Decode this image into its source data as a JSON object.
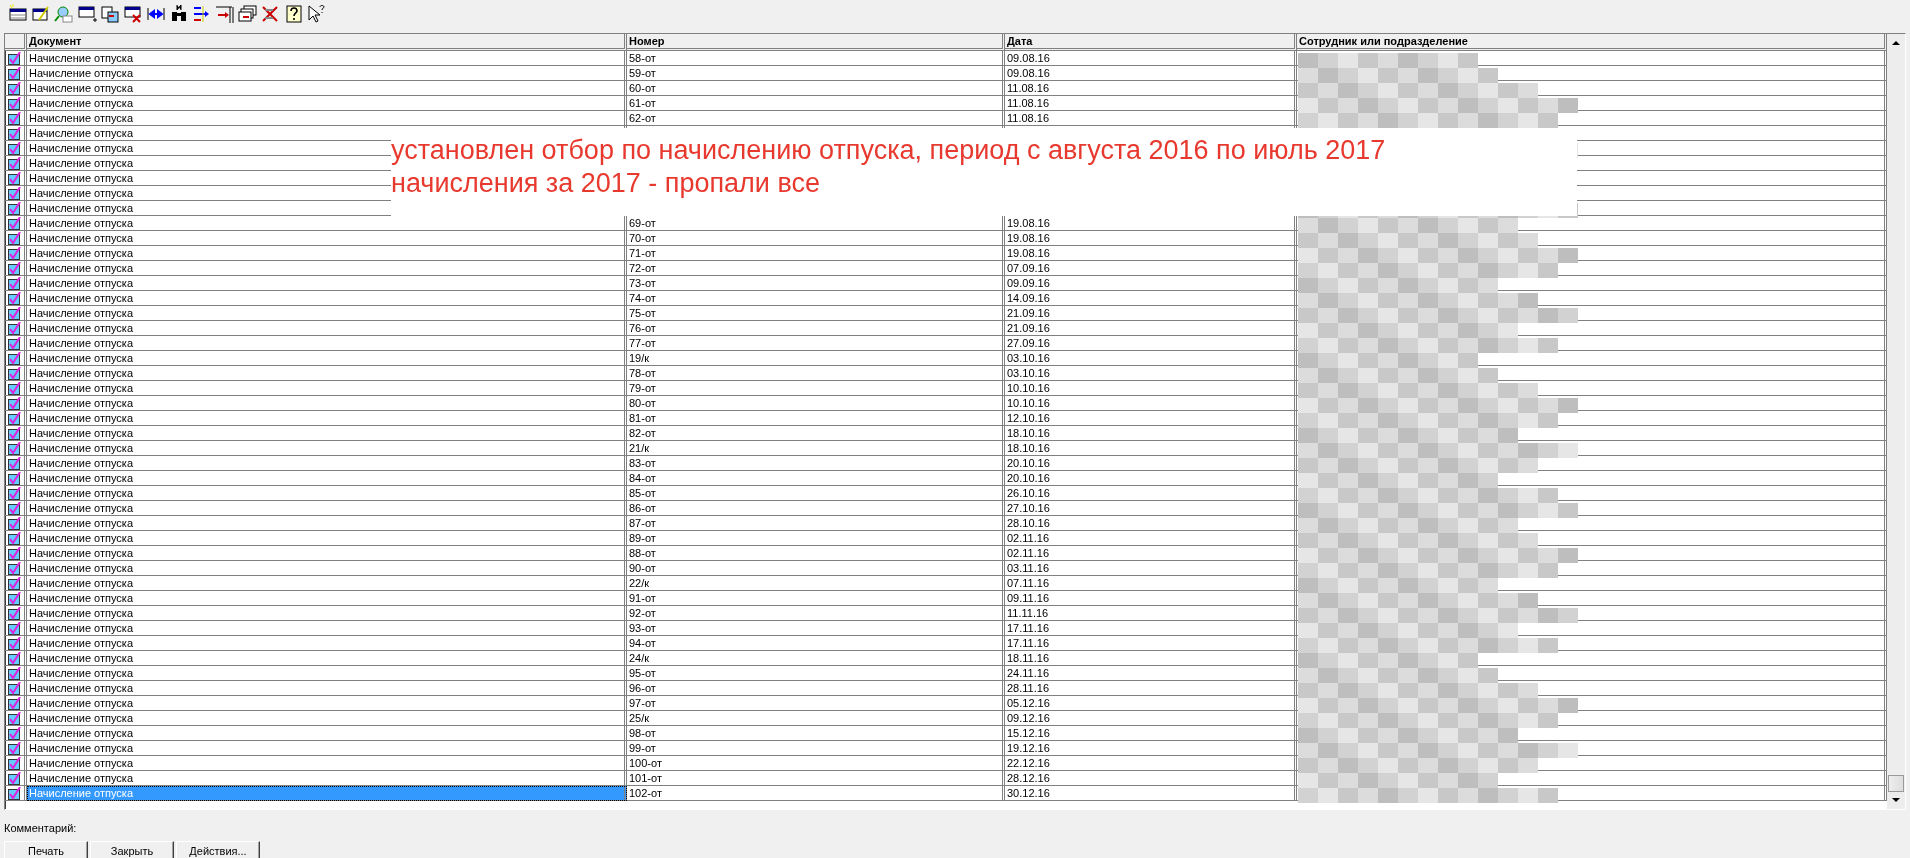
{
  "table": {
    "columns": [
      "Документ",
      "Номер",
      "Дата",
      "Сотрудник или подразделение"
    ],
    "rows": [
      {
        "document": "Начисление отпуска",
        "number": "58-от",
        "date": "09.08.16",
        "selected": false
      },
      {
        "document": "Начисление отпуска",
        "number": "59-от",
        "date": "09.08.16",
        "selected": false
      },
      {
        "document": "Начисление отпуска",
        "number": "60-от",
        "date": "11.08.16",
        "selected": false
      },
      {
        "document": "Начисление отпуска",
        "number": "61-от",
        "date": "11.08.16",
        "selected": false
      },
      {
        "document": "Начисление отпуска",
        "number": "62-от",
        "date": "11.08.16",
        "selected": false
      },
      {
        "document": "Начисление отпуска",
        "selected": false
      },
      {
        "document": "Начисление отпуска",
        "selected": false
      },
      {
        "document": "Начисление отпуска",
        "selected": false
      },
      {
        "document": "Начисление отпуска",
        "selected": false
      },
      {
        "document": "Начисление отпуска",
        "selected": false
      },
      {
        "document": "Начисление отпуска",
        "selected": false
      },
      {
        "document": "Начисление отпуска",
        "number": "69-от",
        "date": "19.08.16",
        "selected": false
      },
      {
        "document": "Начисление отпуска",
        "number": "70-от",
        "date": "19.08.16",
        "selected": false
      },
      {
        "document": "Начисление отпуска",
        "number": "71-от",
        "date": "19.08.16",
        "selected": false
      },
      {
        "document": "Начисление отпуска",
        "number": "72-от",
        "date": "07.09.16",
        "selected": false
      },
      {
        "document": "Начисление отпуска",
        "number": "73-от",
        "date": "09.09.16",
        "selected": false
      },
      {
        "document": "Начисление отпуска",
        "number": "74-от",
        "date": "14.09.16",
        "selected": false
      },
      {
        "document": "Начисление отпуска",
        "number": "75-от",
        "date": "21.09.16",
        "selected": false
      },
      {
        "document": "Начисление отпуска",
        "number": "76-от",
        "date": "21.09.16",
        "selected": false
      },
      {
        "document": "Начисление отпуска",
        "number": "77-от",
        "date": "27.09.16",
        "selected": false
      },
      {
        "document": "Начисление отпуска",
        "number": "19/к",
        "date": "03.10.16",
        "selected": false
      },
      {
        "document": "Начисление отпуска",
        "number": "78-от",
        "date": "03.10.16",
        "selected": false
      },
      {
        "document": "Начисление отпуска",
        "number": "79-от",
        "date": "10.10.16",
        "selected": false
      },
      {
        "document": "Начисление отпуска",
        "number": "80-от",
        "date": "10.10.16",
        "selected": false
      },
      {
        "document": "Начисление отпуска",
        "number": "81-от",
        "date": "12.10.16",
        "selected": false
      },
      {
        "document": "Начисление отпуска",
        "number": "82-от",
        "date": "18.10.16",
        "selected": false
      },
      {
        "document": "Начисление отпуска",
        "number": "21/к",
        "date": "18.10.16",
        "selected": false
      },
      {
        "document": "Начисление отпуска",
        "number": "83-от",
        "date": "20.10.16",
        "selected": false
      },
      {
        "document": "Начисление отпуска",
        "number": "84-от",
        "date": "20.10.16",
        "selected": false
      },
      {
        "document": "Начисление отпуска",
        "number": "85-от",
        "date": "26.10.16",
        "selected": false
      },
      {
        "document": "Начисление отпуска",
        "number": "86-от",
        "date": "27.10.16",
        "selected": false
      },
      {
        "document": "Начисление отпуска",
        "number": "87-от",
        "date": "28.10.16",
        "selected": false
      },
      {
        "document": "Начисление отпуска",
        "number": "89-от",
        "date": "02.11.16",
        "selected": false
      },
      {
        "document": "Начисление отпуска",
        "number": "88-от",
        "date": "02.11.16",
        "selected": false
      },
      {
        "document": "Начисление отпуска",
        "number": "90-от",
        "date": "03.11.16",
        "selected": false
      },
      {
        "document": "Начисление отпуска",
        "number": "22/к",
        "date": "07.11.16",
        "selected": false
      },
      {
        "document": "Начисление отпуска",
        "number": "91-от",
        "date": "09.11.16",
        "selected": false
      },
      {
        "document": "Начисление отпуска",
        "number": "92-от",
        "date": "11.11.16",
        "selected": false
      },
      {
        "document": "Начисление отпуска",
        "number": "93-от",
        "date": "17.11.16",
        "selected": false
      },
      {
        "document": "Начисление отпуска",
        "number": "94-от",
        "date": "17.11.16",
        "selected": false
      },
      {
        "document": "Начисление отпуска",
        "number": "24/к",
        "date": "18.11.16",
        "selected": false
      },
      {
        "document": "Начисление отпуска",
        "number": "95-от",
        "date": "24.11.16",
        "selected": false
      },
      {
        "document": "Начисление отпуска",
        "number": "96-от",
        "date": "28.11.16",
        "selected": false
      },
      {
        "document": "Начисление отпуска",
        "number": "97-от",
        "date": "05.12.16",
        "selected": false
      },
      {
        "document": "Начисление отпуска",
        "number": "25/к",
        "date": "09.12.16",
        "selected": false
      },
      {
        "document": "Начисление отпуска",
        "number": "98-от",
        "date": "15.12.16",
        "selected": false
      },
      {
        "document": "Начисление отпуска",
        "number": "99-от",
        "date": "19.12.16",
        "selected": false
      },
      {
        "document": "Начисление отпуска",
        "number": "100-от",
        "date": "22.12.16",
        "selected": false
      },
      {
        "document": "Начисление отпуска",
        "number": "101-от",
        "date": "28.12.16",
        "selected": false
      },
      {
        "document": "Начисление отпуска",
        "number": "102-от",
        "date": "30.12.16",
        "selected": true
      }
    ]
  },
  "annotation": [
    "установлен отбор по начислению отпуска, период с августа 2016 по июль 2017",
    "начисления за 2017 - пропали все"
  ],
  "comment_label": "Комментарий:",
  "buttons": [
    "Печать",
    "Закрыть",
    "Действия..."
  ]
}
